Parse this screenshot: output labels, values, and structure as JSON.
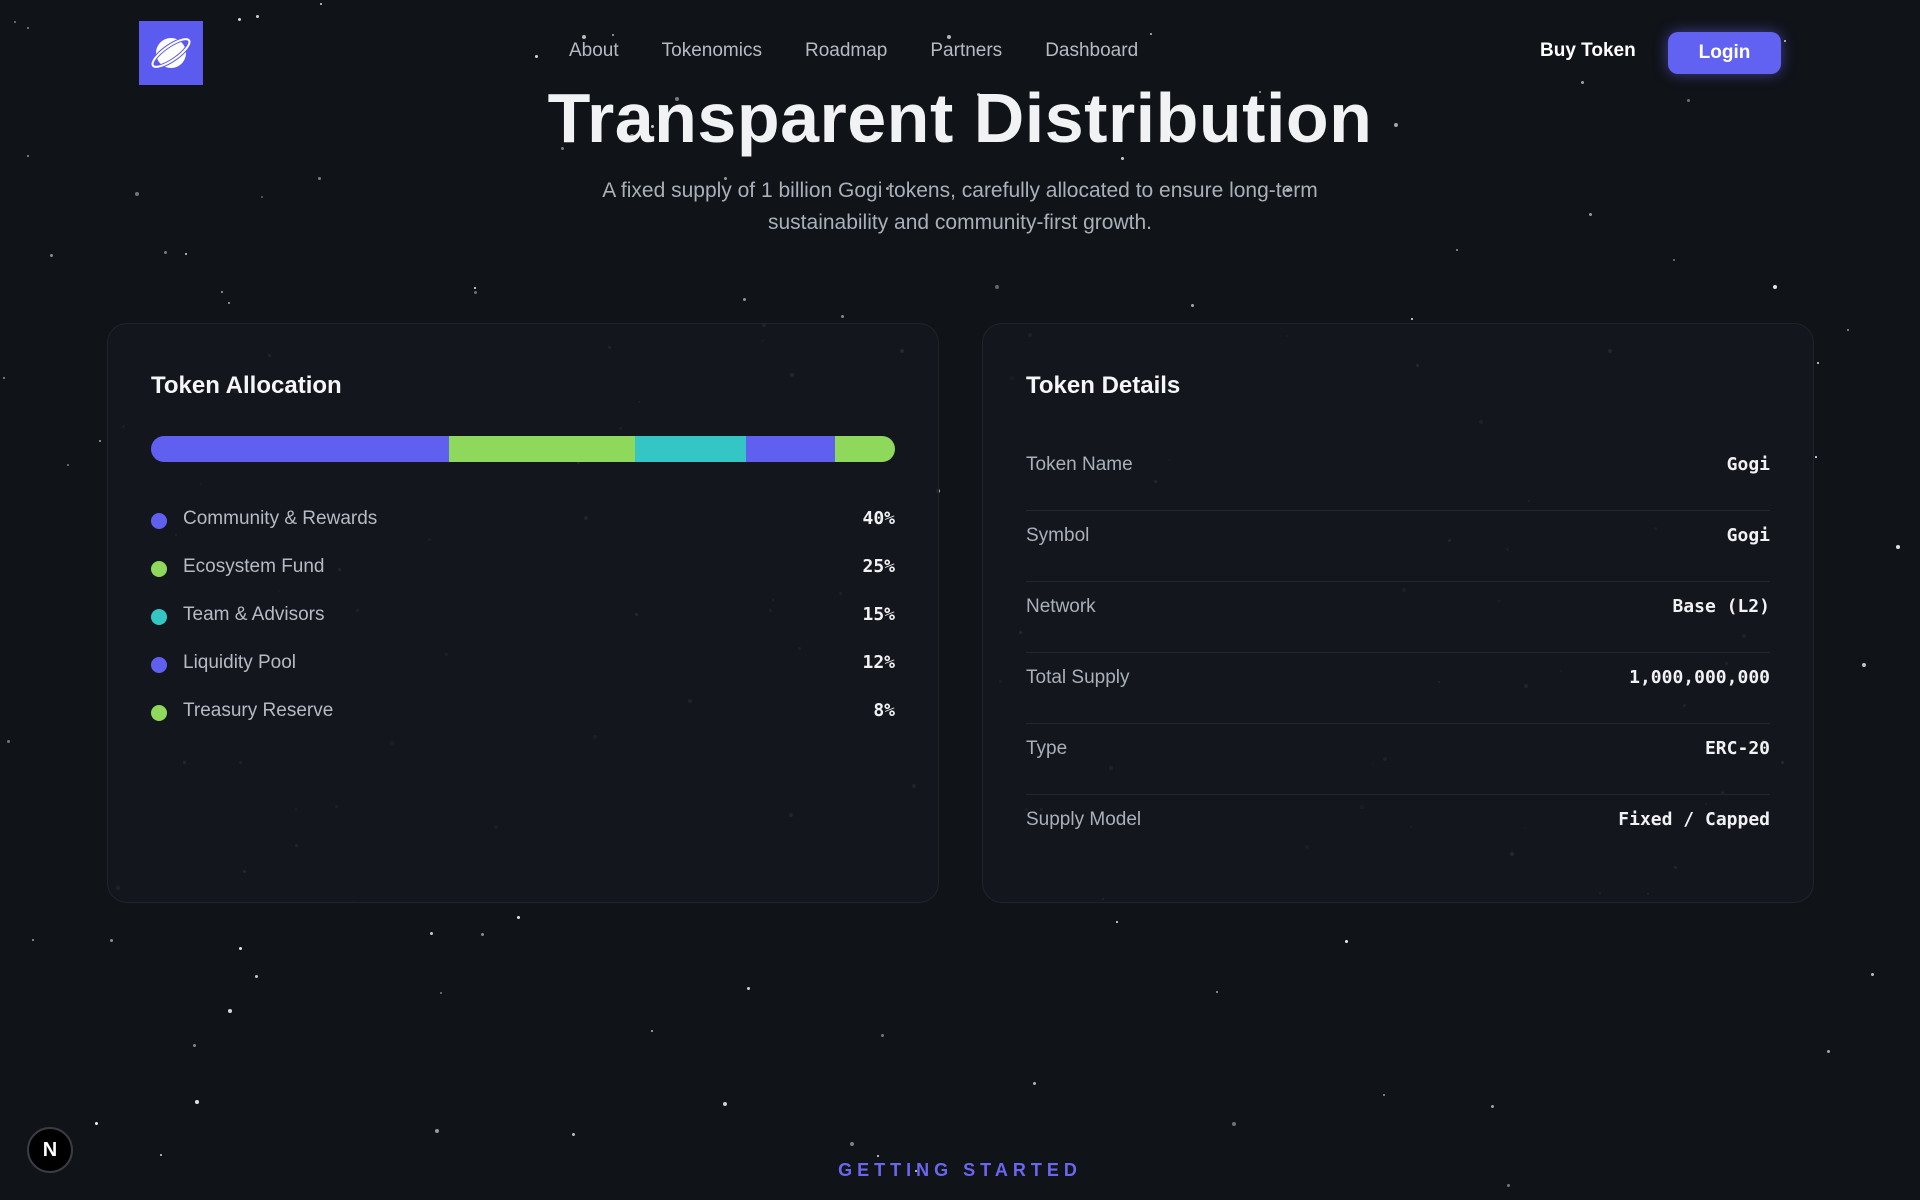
{
  "nav": {
    "links": [
      "About",
      "Tokenomics",
      "Roadmap",
      "Partners",
      "Dashboard"
    ],
    "buy_label": "Buy Token",
    "login_label": "Login",
    "logo_icon": "planet-icon"
  },
  "hero": {
    "title": "Transparent Distribution",
    "subtitle": "A fixed supply of 1 billion Gogi tokens, carefully allocated to ensure long-term sustainability and community-first growth."
  },
  "allocation": {
    "title": "Token Allocation",
    "items": [
      {
        "label": "Community & Rewards",
        "percent_text": "40%",
        "percent": 40,
        "color": "#6060f0"
      },
      {
        "label": "Ecosystem Fund",
        "percent_text": "25%",
        "percent": 25,
        "color": "#8ed95c"
      },
      {
        "label": "Team & Advisors",
        "percent_text": "15%",
        "percent": 15,
        "color": "#34c6c4"
      },
      {
        "label": "Liquidity Pool",
        "percent_text": "12%",
        "percent": 12,
        "color": "#6060f0"
      },
      {
        "label": "Treasury Reserve",
        "percent_text": "8%",
        "percent": 8,
        "color": "#8ed95c"
      }
    ]
  },
  "details": {
    "title": "Token Details",
    "rows": [
      {
        "label": "Token Name",
        "value": "Gogi"
      },
      {
        "label": "Symbol",
        "value": "Gogi"
      },
      {
        "label": "Network",
        "value": "Base (L2)"
      },
      {
        "label": "Total Supply",
        "value": "1,000,000,000"
      },
      {
        "label": "Type",
        "value": "ERC-20"
      },
      {
        "label": "Supply Model",
        "value": "Fixed / Capped"
      }
    ]
  },
  "next_section": {
    "label": "GETTING STARTED"
  },
  "badge": {
    "letter": "N"
  },
  "colors": {
    "background": "#101318",
    "accent": "#6262f2",
    "green": "#8ed95c",
    "teal": "#34c6c4"
  }
}
